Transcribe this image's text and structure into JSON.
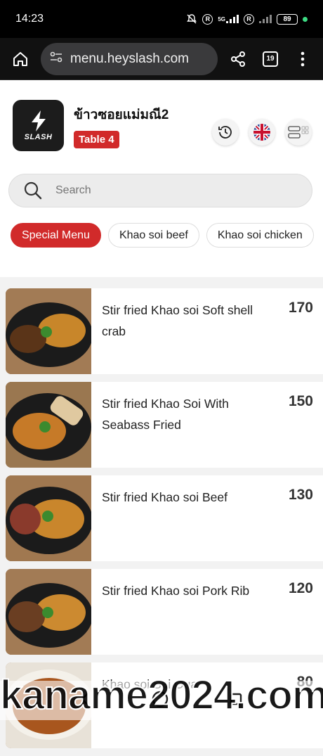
{
  "status": {
    "time": "14:23",
    "net": "5G",
    "battery": "89"
  },
  "browser": {
    "url": "menu.heyslash.com",
    "tab_count": "19"
  },
  "shop": {
    "logo_text": "SLASH",
    "name": "ข้าวซอยแม่มณี2",
    "table": "Table 4"
  },
  "search": {
    "placeholder": "Search"
  },
  "chips": [
    "Special Menu",
    "Khao soi beef",
    "Khao soi chicken"
  ],
  "menu": [
    {
      "name": "Stir fried Khao soi Soft shell crab",
      "price": "170"
    },
    {
      "name": "Stir fried Khao Soi With Seabass Fried",
      "price": "150"
    },
    {
      "name": "Stir fried Khao soi Beef",
      "price": "130"
    },
    {
      "name": "Stir fried Khao soi Pork Rib",
      "price": "120"
    },
    {
      "name": "Khao soi Sai Oua",
      "price": "80"
    }
  ],
  "watermark": "kaname2024.com"
}
